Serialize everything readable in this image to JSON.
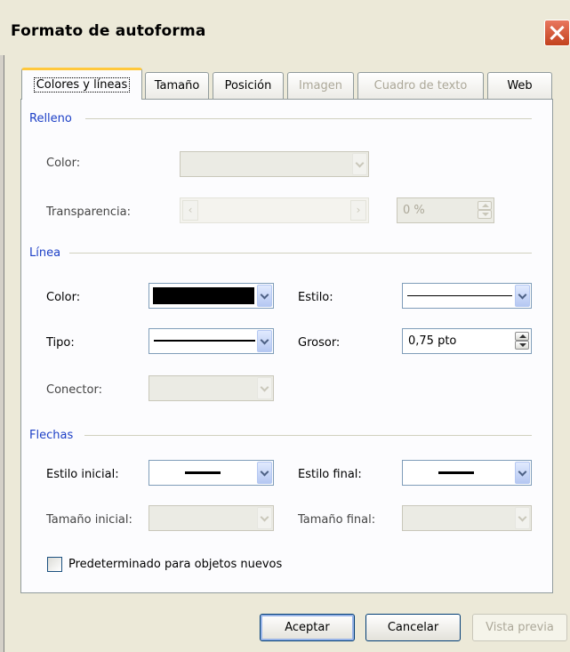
{
  "window": {
    "title": "Formato de autoforma"
  },
  "tabs": [
    {
      "label": "Colores y líneas",
      "active": true,
      "enabled": true
    },
    {
      "label": "Tamaño",
      "active": false,
      "enabled": true
    },
    {
      "label": "Posición",
      "active": false,
      "enabled": true
    },
    {
      "label": "Imagen",
      "active": false,
      "enabled": false
    },
    {
      "label": "Cuadro de texto",
      "active": false,
      "enabled": false
    },
    {
      "label": "Web",
      "active": false,
      "enabled": true
    }
  ],
  "relleno": {
    "heading": "Relleno",
    "color_label": "Color:",
    "color_value": "",
    "transparencia_label": "Transparencia:",
    "transparencia_value": "0 %"
  },
  "linea": {
    "heading": "Línea",
    "color_label": "Color:",
    "color_value": "#000000",
    "estilo_label": "Estilo:",
    "tipo_label": "Tipo:",
    "grosor_label": "Grosor:",
    "grosor_value": "0,75 pto",
    "conector_label": "Conector:"
  },
  "flechas": {
    "heading": "Flechas",
    "estilo_inicial_label": "Estilo inicial:",
    "estilo_final_label": "Estilo final:",
    "tamano_inicial_label": "Tamaño inicial:",
    "tamano_final_label": "Tamaño final:"
  },
  "default_checkbox": {
    "label": "Predeterminado para objetos nuevos",
    "checked": false
  },
  "buttons": {
    "ok": "Aceptar",
    "cancel": "Cancelar",
    "preview": "Vista previa"
  }
}
